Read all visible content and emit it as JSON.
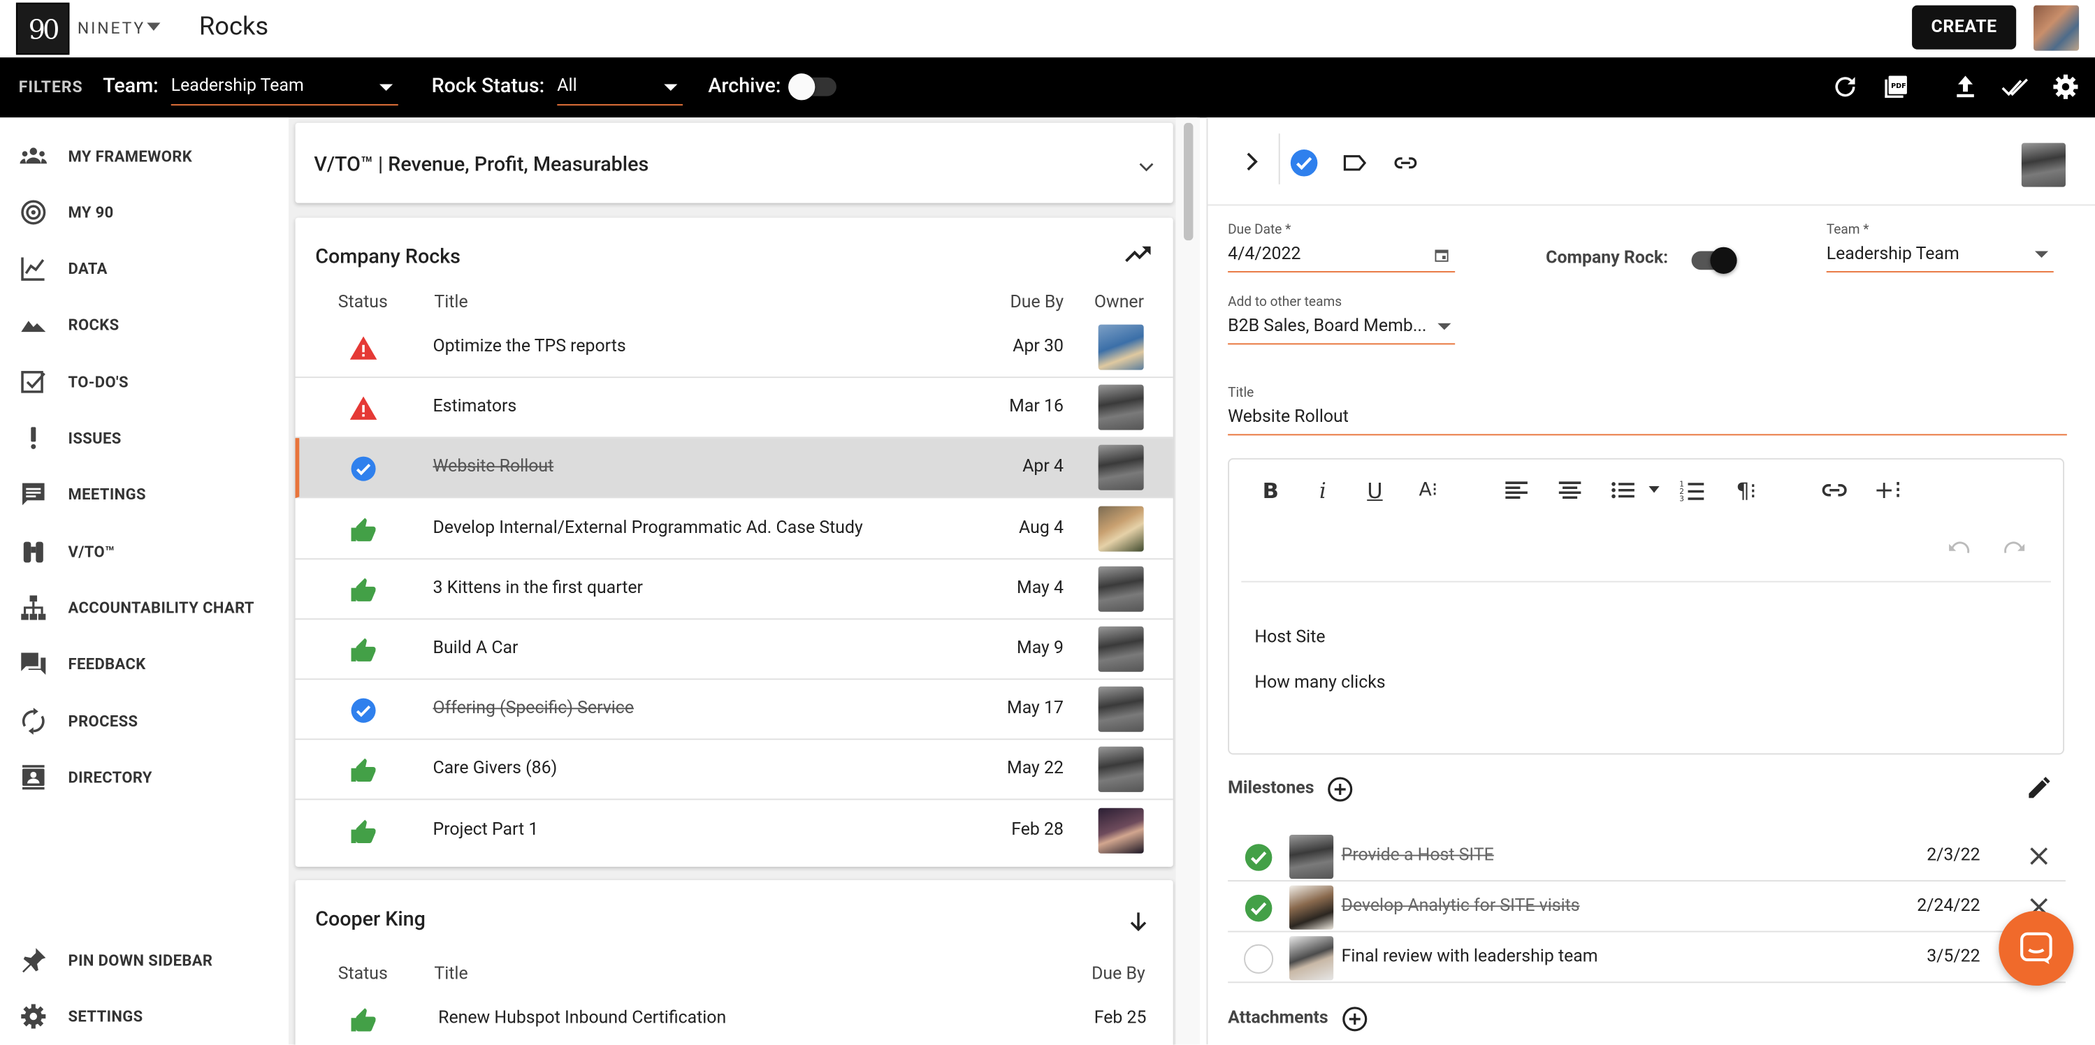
{
  "app": {
    "logo_mark": "90",
    "logo_text": "NINETY",
    "page_title": "Rocks",
    "create_label": "CREATE"
  },
  "filters": {
    "label": "FILTERS",
    "team_label": "Team:",
    "team_value": "Leadership Team",
    "status_label": "Rock Status:",
    "status_value": "All",
    "archive_label": "Archive:",
    "archive_on": false,
    "accent_color": "#e8743b"
  },
  "sidebar": {
    "items": [
      {
        "label": "MY FRAMEWORK",
        "icon": "people-icon"
      },
      {
        "label": "MY 90",
        "icon": "target-icon"
      },
      {
        "label": "DATA",
        "icon": "line-chart-icon"
      },
      {
        "label": "ROCKS",
        "icon": "mountain-icon"
      },
      {
        "label": "TO-DO'S",
        "icon": "checkbox-icon"
      },
      {
        "label": "ISSUES",
        "icon": "exclamation-icon"
      },
      {
        "label": "MEETINGS",
        "icon": "chat-bubble-icon"
      },
      {
        "label": "V/TO™",
        "icon": "binoculars-icon"
      },
      {
        "label": "ACCOUNTABILITY CHART",
        "icon": "org-chart-icon"
      },
      {
        "label": "FEEDBACK",
        "icon": "forum-icon"
      },
      {
        "label": "PROCESS",
        "icon": "sync-icon"
      },
      {
        "label": "DIRECTORY",
        "icon": "contacts-icon"
      }
    ],
    "footer": [
      {
        "label": "PIN DOWN SIDEBAR",
        "icon": "pin-icon"
      },
      {
        "label": "SETTINGS",
        "icon": "gear-icon"
      }
    ]
  },
  "vto": {
    "title": "V/TO™ | Revenue, Profit, Measurables"
  },
  "company_rocks": {
    "title": "Company Rocks",
    "headers": {
      "status": "Status",
      "title": "Title",
      "due": "Due By",
      "owner": "Owner"
    },
    "rows": [
      {
        "status": "off-track",
        "title": "Optimize the TPS reports",
        "due": "Apr 30",
        "done": false
      },
      {
        "status": "off-track",
        "title": "Estimators",
        "due": "Mar 16",
        "done": false
      },
      {
        "status": "done",
        "title": "Website Rollout",
        "due": "Apr 4",
        "done": true,
        "selected": true
      },
      {
        "status": "on-track",
        "title": "Develop Internal/External Programmatic Ad. Case Study",
        "due": "Aug 4",
        "done": false
      },
      {
        "status": "on-track",
        "title": "3 Kittens in the first quarter",
        "due": "May 4",
        "done": false
      },
      {
        "status": "on-track",
        "title": "Build A Car",
        "due": "May 9",
        "done": false
      },
      {
        "status": "done",
        "title": "Offering (Specific) Service",
        "due": "May 17",
        "done": true
      },
      {
        "status": "on-track",
        "title": "Care Givers (86)",
        "due": "May 22",
        "done": false
      },
      {
        "status": "on-track",
        "title": "Project Part 1",
        "due": "Feb 28",
        "done": false
      }
    ]
  },
  "cooper_king": {
    "title": "Cooper King",
    "headers": {
      "status": "Status",
      "title": "Title",
      "due": "Due By"
    },
    "rows": [
      {
        "status": "on-track",
        "title": "Renew Hubspot Inbound Certification",
        "due": "Feb 25"
      }
    ]
  },
  "detail": {
    "due_date_label": "Due Date *",
    "due_date_value": "4/4/2022",
    "company_rock_label": "Company Rock:",
    "company_rock_on": true,
    "team_label": "Team *",
    "team_value": "Leadership Team",
    "other_teams_label": "Add to other teams",
    "other_teams_value": "B2B Sales, Board Memb...",
    "title_label": "Title",
    "title_value": "Website Rollout",
    "description": [
      "Host Site",
      "How many clicks"
    ],
    "milestones_label": "Milestones",
    "milestones": [
      {
        "title": "Provide a Host SITE",
        "date": "2/3/22",
        "done": true
      },
      {
        "title": "Develop Analytic for SITE visits",
        "date": "2/24/22",
        "done": true
      },
      {
        "title": "Final review with leadership team",
        "date": "3/5/22",
        "done": false
      }
    ],
    "attachments_label": "Attachments"
  },
  "colors": {
    "on_track": "#43a047",
    "off_track": "#e53935",
    "done": "#2f80ed",
    "accent": "#e8743b",
    "fab": "#f06a2b"
  }
}
